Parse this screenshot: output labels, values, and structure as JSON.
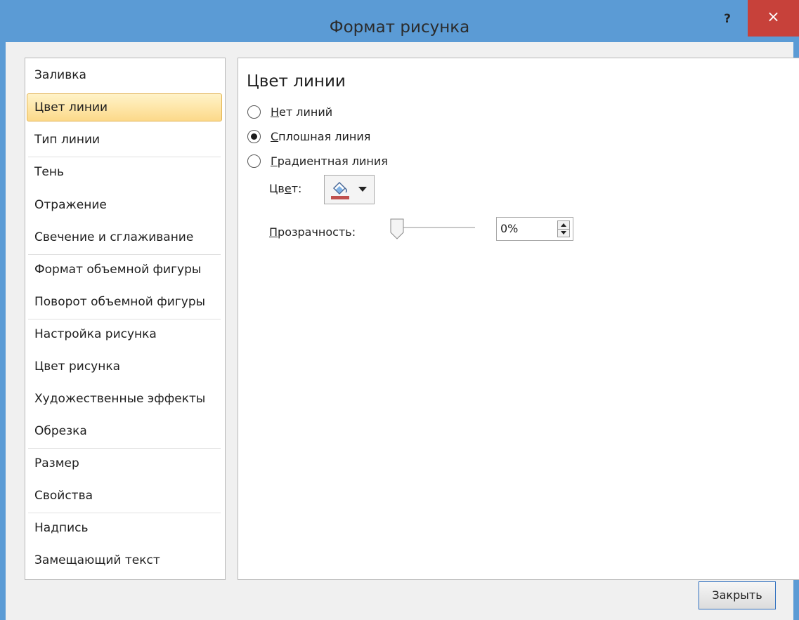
{
  "window": {
    "title": "Формат рисунка",
    "help_label": "?",
    "close_label": "×"
  },
  "sidebar": {
    "items": [
      {
        "label": "Заливка"
      },
      {
        "label": "Цвет линии",
        "selected": true
      },
      {
        "label": "Тип линии"
      },
      {
        "label": "Тень"
      },
      {
        "label": "Отражение"
      },
      {
        "label": "Свечение и сглаживание"
      },
      {
        "label": "Формат объемной фигуры"
      },
      {
        "label": "Поворот объемной фигуры"
      },
      {
        "label": "Настройка рисунка"
      },
      {
        "label": "Цвет рисунка"
      },
      {
        "label": "Художественные эффекты"
      },
      {
        "label": "Обрезка"
      },
      {
        "label": "Размер"
      },
      {
        "label": "Свойства"
      },
      {
        "label": "Надпись"
      },
      {
        "label": "Замещающий текст"
      }
    ]
  },
  "panel": {
    "title": "Цвет линии",
    "options": [
      {
        "hotkey": "Н",
        "rest": "ет линий",
        "checked": false
      },
      {
        "hotkey": "С",
        "rest": "плошная линия",
        "checked": true
      },
      {
        "hotkey": "Г",
        "rest": "радиентная линия",
        "checked": false
      }
    ],
    "color_label_pre": "Цв",
    "color_label_hotkey": "е",
    "color_label_post": "т:",
    "color_swatch": "#c0504d",
    "transparency_hotkey": "П",
    "transparency_rest": "розрачность:",
    "transparency_value": "0%",
    "transparency_fraction": 0
  },
  "footer": {
    "close_button": "Закрыть"
  },
  "colors": {
    "titlebar": "#5b9bd5",
    "close": "#c7413a",
    "selected_item": "#fcd98a"
  }
}
